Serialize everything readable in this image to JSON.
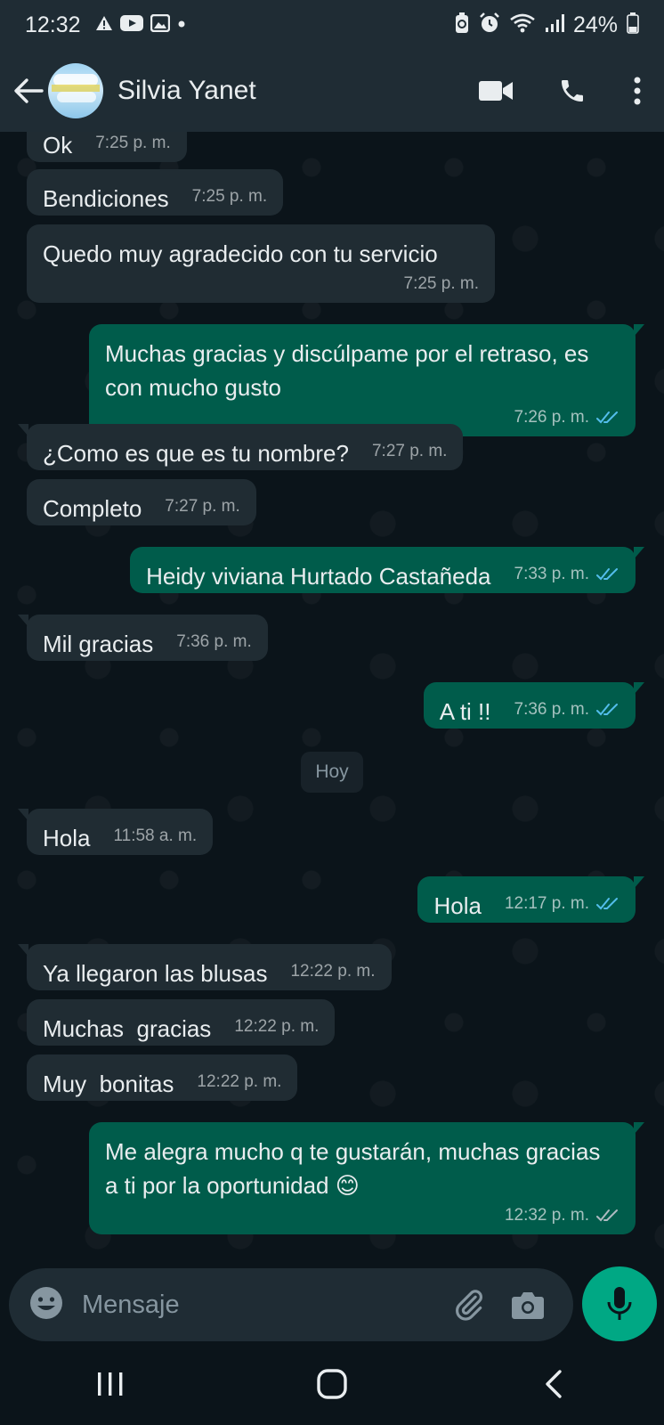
{
  "status_bar": {
    "time": "12:32",
    "battery": "24%"
  },
  "header": {
    "contact_name": "Silvia Yanet"
  },
  "colors": {
    "incoming": "#202c33",
    "outgoing": "#005c4b",
    "accent": "#00a884",
    "tick_read": "#53bdeb"
  },
  "messages": [
    {
      "dir": "in",
      "text": "Ok",
      "time": "7:25 p. m."
    },
    {
      "dir": "in",
      "text": "Bendiciones",
      "time": "7:25 p. m."
    },
    {
      "dir": "in",
      "text": "Quedo muy agradecido con tu servicio",
      "time": "7:25 p. m."
    },
    {
      "dir": "out",
      "text": "Muchas gracias y discúlpame por el retraso, es con mucho gusto",
      "time": "7:26 p. m.",
      "status": "read"
    },
    {
      "dir": "in",
      "text": "¿Como es que es tu nombre?",
      "time": "7:27 p. m."
    },
    {
      "dir": "in",
      "text": "Completo",
      "time": "7:27 p. m."
    },
    {
      "dir": "out",
      "text": "Heidy viviana Hurtado Castañeda",
      "time": "7:33 p. m.",
      "status": "read"
    },
    {
      "dir": "in",
      "text": "Mil gracias",
      "time": "7:36 p. m."
    },
    {
      "dir": "out",
      "text": "A ti !!",
      "time": "7:36 p. m.",
      "status": "read"
    },
    {
      "dir": "in",
      "text": "Hola",
      "time": "11:58 a. m."
    },
    {
      "dir": "out",
      "text": "Hola",
      "time": "12:17 p. m.",
      "status": "read"
    },
    {
      "dir": "in",
      "text": "Ya llegaron las blusas",
      "time": "12:22 p. m."
    },
    {
      "dir": "in",
      "text": "Muchas  gracias",
      "time": "12:22 p. m."
    },
    {
      "dir": "in",
      "text": "Muy  bonitas",
      "time": "12:22 p. m."
    },
    {
      "dir": "out",
      "text": "Me alegra mucho q te gustarán, muchas gracias a ti por la oportunidad 😊",
      "time": "12:32 p. m.",
      "status": "delivered"
    }
  ],
  "date_separator": "Hoy",
  "composer": {
    "placeholder": "Mensaje"
  }
}
